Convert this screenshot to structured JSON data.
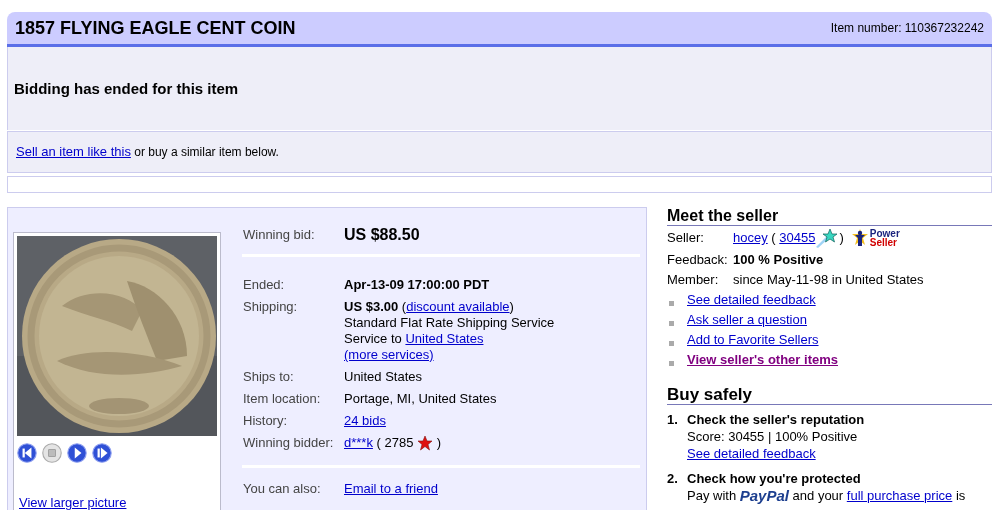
{
  "header": {
    "title": "1857 FLYING EAGLE CENT COIN",
    "item_number": "Item number: 110367232242"
  },
  "status": {
    "message": "Bidding has ended for this item"
  },
  "sell": {
    "link": "Sell an item like this",
    "text": " or buy a similar item below."
  },
  "gallery": {
    "controls": [
      {
        "kind": "previous",
        "disabled": false
      },
      {
        "kind": "stop",
        "disabled": true
      },
      {
        "kind": "play",
        "disabled": false
      },
      {
        "kind": "next",
        "disabled": false
      }
    ],
    "link": "View larger picture"
  },
  "winning_bid": {
    "label": "Winning bid:",
    "value": "US $88.50"
  },
  "details": [
    {
      "label": "Ended:",
      "lines": [
        [
          {
            "kind": "bold",
            "text": "Apr-13-09 17:00:00 PDT"
          }
        ]
      ]
    },
    {
      "label": "Shipping:",
      "lines": [
        [
          {
            "kind": "bold",
            "text": "US $3.00"
          },
          {
            "kind": "text",
            "text": " ("
          },
          {
            "kind": "link",
            "text": "discount available"
          },
          {
            "kind": "text",
            "text": ")"
          }
        ],
        [
          {
            "kind": "text",
            "text": "Standard Flat Rate Shipping Service"
          }
        ],
        [
          {
            "kind": "text",
            "text": "Service to "
          },
          {
            "kind": "link",
            "text": "United States"
          }
        ],
        [
          {
            "kind": "link",
            "text": "(more services)"
          }
        ]
      ]
    },
    {
      "label": "Ships to:",
      "lines": [
        [
          {
            "kind": "text",
            "text": "United States"
          }
        ]
      ]
    },
    {
      "label": "Item location:",
      "lines": [
        [
          {
            "kind": "text",
            "text": "Portage, MI, United States"
          }
        ]
      ]
    },
    {
      "label": "History:",
      "lines": [
        [
          {
            "kind": "link",
            "text": "24 bids"
          }
        ]
      ]
    },
    {
      "label": "Winning bidder:",
      "lines": [
        [
          {
            "kind": "link",
            "text": "d***k"
          },
          {
            "kind": "text",
            "text": " ( 2785 "
          },
          {
            "kind": "star"
          },
          {
            "kind": "text",
            "text": " )"
          }
        ]
      ]
    }
  ],
  "also": {
    "label": "You can also:",
    "link": "Email to a friend"
  },
  "seller": {
    "heading": "Meet the seller",
    "rows": [
      {
        "label": "Seller:",
        "segments": [
          {
            "kind": "link",
            "text": "hocey"
          },
          {
            "kind": "text",
            "text": " ( "
          },
          {
            "kind": "link",
            "text": "30455"
          },
          {
            "kind": "shooting_star"
          },
          {
            "kind": "text",
            "text": ")"
          },
          {
            "kind": "power_seller",
            "words": [
              "Power",
              "Seller"
            ]
          }
        ]
      },
      {
        "label": "Feedback:",
        "segments": [
          {
            "kind": "bold",
            "text": "100 % Positive"
          }
        ]
      },
      {
        "label": "Member:",
        "segments": [
          {
            "kind": "text",
            "text": "since May-11-98 in United States"
          }
        ]
      }
    ],
    "links": [
      {
        "text": "See detailed feedback",
        "visited": false
      },
      {
        "text": "Ask seller a question",
        "visited": false
      },
      {
        "text": "Add to Favorite Sellers",
        "visited": false
      },
      {
        "text": "View seller's other items",
        "visited": true
      }
    ]
  },
  "buy_safely": {
    "heading": "Buy safely",
    "steps": [
      {
        "number": "1.",
        "title": "Check the seller's reputation",
        "lines": [
          [
            {
              "kind": "text",
              "text": "Score: 30455 | 100% Positive"
            }
          ],
          [
            {
              "kind": "link",
              "text": "See detailed feedback"
            }
          ]
        ]
      },
      {
        "number": "2.",
        "title": "Check how you're protected",
        "lines": [
          [
            {
              "kind": "text",
              "text": "Pay with "
            },
            {
              "kind": "logo",
              "text": "PayPal"
            },
            {
              "kind": "text",
              "text": " and your "
            },
            {
              "kind": "link",
              "text": "full purchase price"
            },
            {
              "kind": "text",
              "text": " is"
            }
          ]
        ]
      }
    ]
  }
}
